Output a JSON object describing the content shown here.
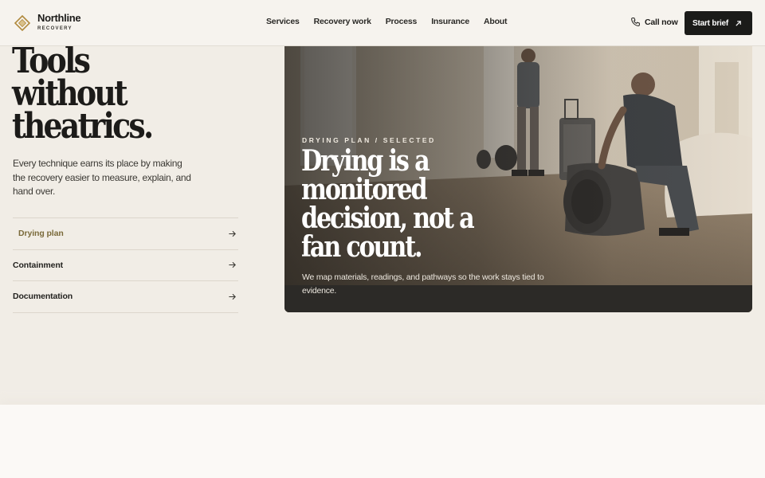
{
  "brand": {
    "name": "Northline",
    "sub": "RECOVERY"
  },
  "nav": [
    "Services",
    "Recovery work",
    "Process",
    "Insurance",
    "About"
  ],
  "header": {
    "call_label": "Call now",
    "cta_label": "Start brief"
  },
  "hero": {
    "headline": [
      "Tools",
      "without",
      "theatrics."
    ],
    "lede": "Every technique earns its place by making the recovery easier to measure, explain, and hand over."
  },
  "tabs": [
    {
      "label": "Drying plan",
      "active": true
    },
    {
      "label": "Containment",
      "active": false
    },
    {
      "label": "Documentation",
      "active": false
    }
  ],
  "feature": {
    "eyebrow": "DRYING PLAN / SELECTED",
    "title": [
      "Drying is a",
      "monitored",
      "decision, not a",
      "fan count."
    ],
    "description": "We map materials, readings, and pathways so the work stays tied to evidence."
  },
  "colors": {
    "accent": "#b08a3e",
    "dark": "#1b1b19",
    "background": "#f1ede6"
  },
  "icons": {
    "logo": "diamond-logo-icon",
    "phone": "phone-icon",
    "external": "arrow-up-right-icon",
    "tab_arrow": "arrow-right-icon"
  }
}
